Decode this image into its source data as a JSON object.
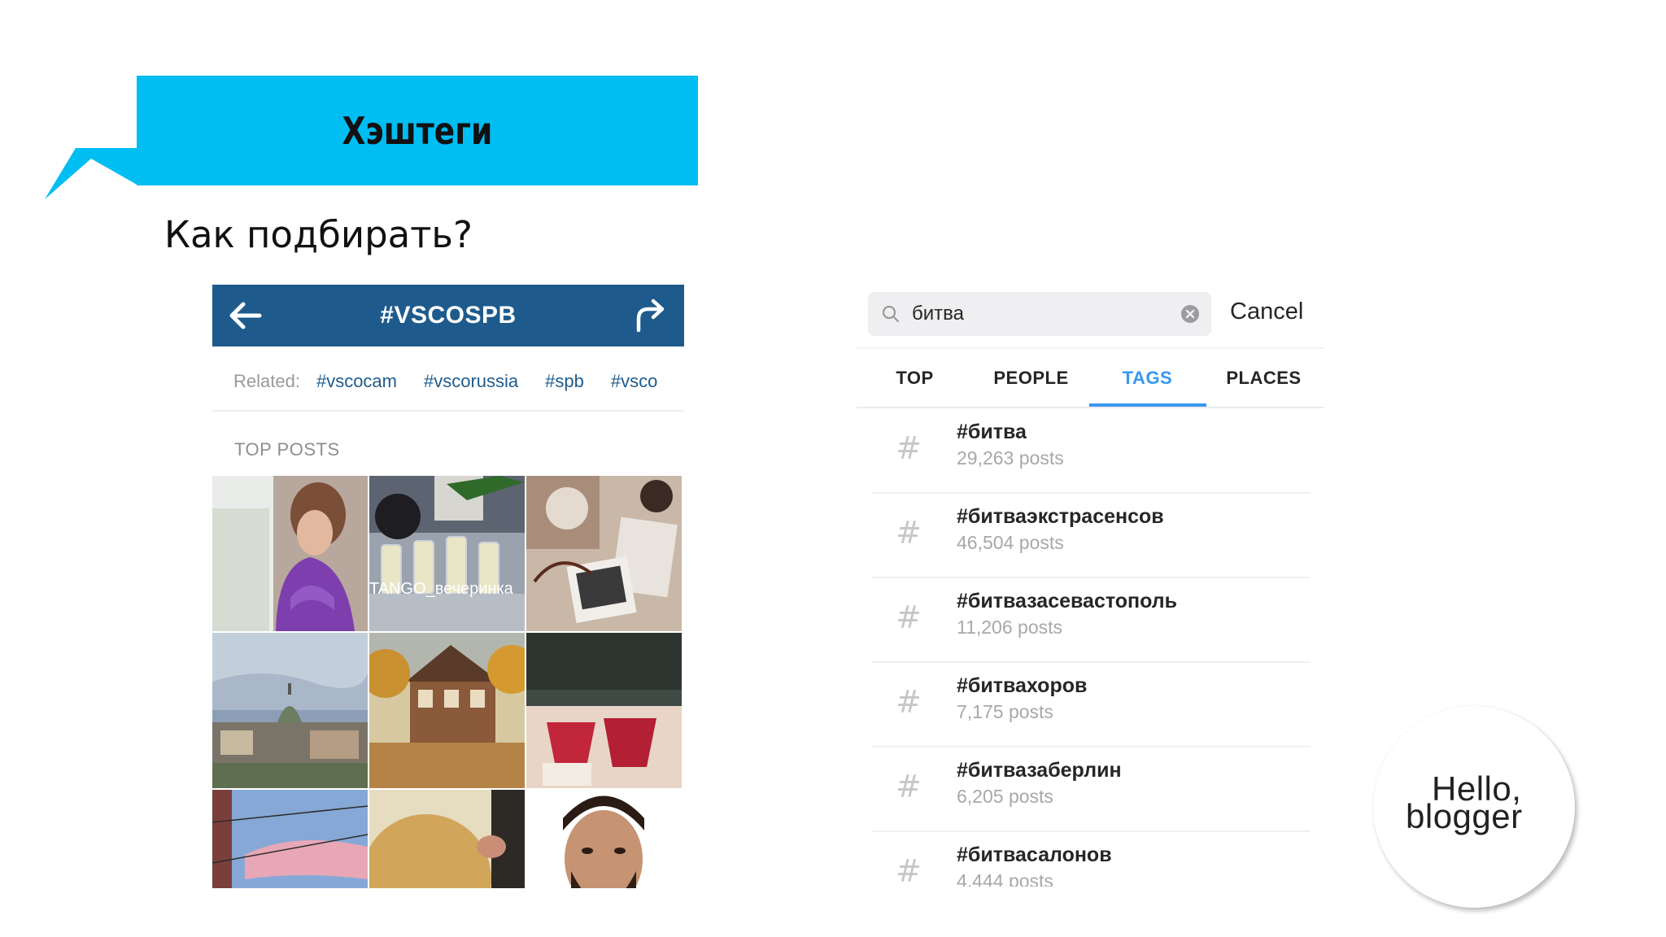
{
  "slide": {
    "title": "Хэштеги",
    "subtitle": "Как подбирать?",
    "banner_color": "#00bdf2"
  },
  "hashtag_page": {
    "header_title": "#VSCOSPB",
    "header_color": "#1e5b8c",
    "back_icon": "arrow-left-icon",
    "share_icon": "share-arrow-icon",
    "related_label": "Related:",
    "related_tags": [
      "#vscocam",
      "#vscorussia",
      "#spb",
      "#vsco"
    ],
    "top_posts_label": "TOP POSTS",
    "photo_text": "TANGO_вечеринка"
  },
  "search": {
    "query": "битва",
    "search_icon": "magnifier-icon",
    "clear_icon": "clear-circle-icon",
    "cancel_label": "Cancel",
    "tabs": [
      {
        "label": "TOP",
        "active": false
      },
      {
        "label": "PEOPLE",
        "active": false
      },
      {
        "label": "TAGS",
        "active": true
      },
      {
        "label": "PLACES",
        "active": false
      }
    ],
    "accent_color": "#3897f0",
    "results": [
      {
        "symbol": "#",
        "tag": "#битва",
        "count": "29,263 posts"
      },
      {
        "symbol": "#",
        "tag": "#битваэкстрасенсов",
        "count": "46,504 posts"
      },
      {
        "symbol": "#",
        "tag": "#битвазасевастополь",
        "count": "11,206 posts"
      },
      {
        "symbol": "#",
        "tag": "#битвахоров",
        "count": "7,175 posts"
      },
      {
        "symbol": "#",
        "tag": "#битвазаберлин",
        "count": "6,205 posts"
      },
      {
        "symbol": "#",
        "tag": "#битвасалонов",
        "count": "4,444 posts"
      }
    ]
  },
  "logo": {
    "line1": "Hello,",
    "line2": "blogger"
  }
}
